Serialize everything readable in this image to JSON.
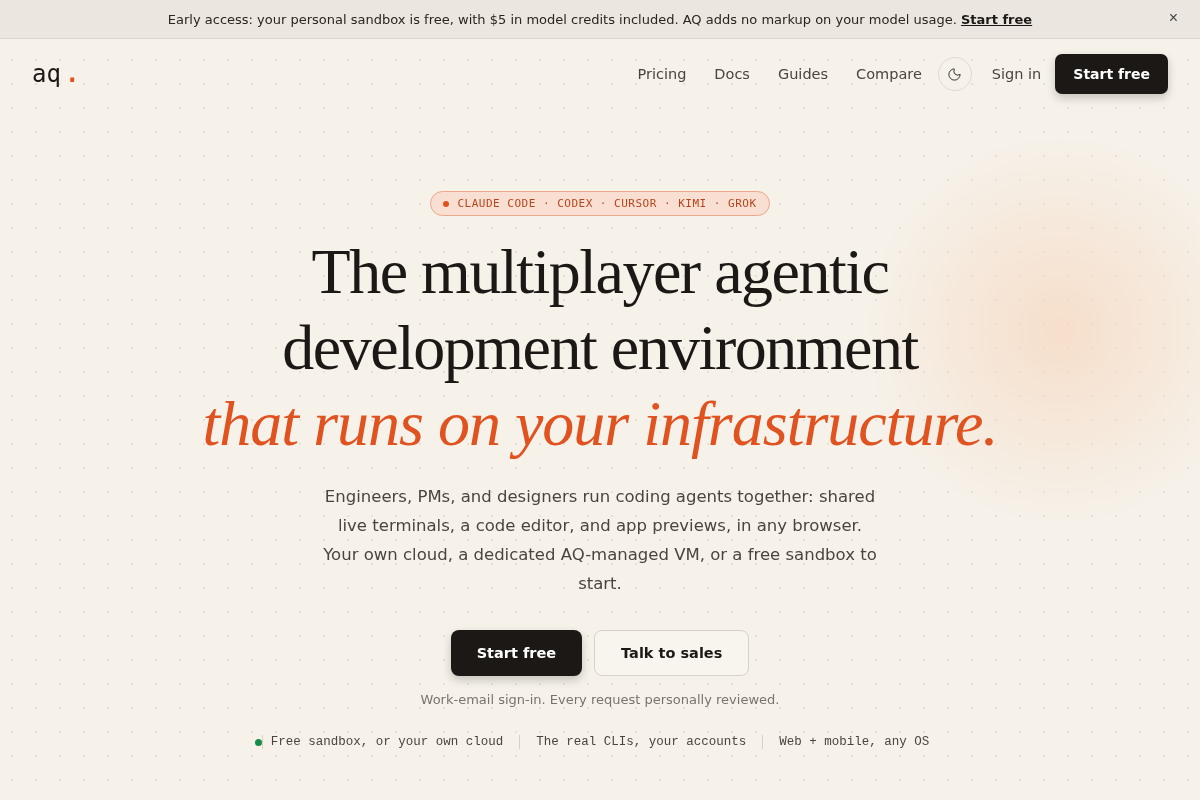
{
  "banner": {
    "text": "Early access: your personal sandbox is free, with $5 in model credits included. AQ adds no markup on your model usage.",
    "link": "Start free",
    "close": "×"
  },
  "nav": {
    "logo": "aq",
    "logo_dot": ".",
    "links": [
      "Pricing",
      "Docs",
      "Guides",
      "Compare"
    ],
    "sign_in": "Sign in",
    "cta": "Start free"
  },
  "hero": {
    "badge": "CLAUDE CODE · CODEX · CURSOR · KIMI · GROK",
    "title_lines": [
      "The multiplayer agentic",
      "development environment"
    ],
    "title_accent": "that runs on your infrastructure.",
    "description": "Engineers, PMs, and designers run coding agents together: shared live terminals, a code editor, and app previews, in any browser. Your own cloud, a dedicated AQ-managed VM, or a free sandbox to start.",
    "primary_button": "Start free",
    "secondary_button": "Talk to sales",
    "note": "Work-email sign-in. Every request personally reviewed.",
    "features": [
      "Free sandbox, or your own cloud",
      "The real CLIs, your accounts",
      "Web + mobile, any OS"
    ]
  }
}
